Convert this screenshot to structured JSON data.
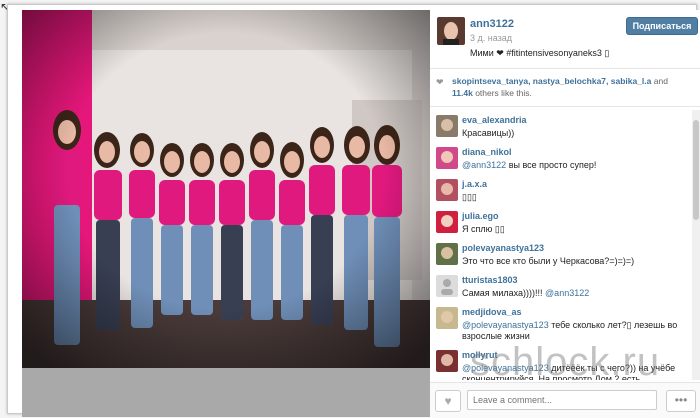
{
  "post": {
    "username": "ann3122",
    "time_ago": "3 д. назад",
    "caption": "Мими ❤ #fitintensivesonyaneks3 ▯",
    "follow_label": "Подписаться"
  },
  "likes": {
    "users": "skopintseva_tanya, nastya_belochka7, sabika_l.a",
    "and_word": "and",
    "count": "11.4k",
    "suffix": "others like this."
  },
  "comments": [
    {
      "author": "eva_alexandria",
      "text": "Красавицы))"
    },
    {
      "author": "diana_nikol",
      "mention": "@ann3122",
      "text": " вы все просто супер!"
    },
    {
      "author": "j.a.x.a",
      "text": "▯▯▯"
    },
    {
      "author": "julia.ego",
      "text": "Я сплю ▯▯"
    },
    {
      "author": "polevayanastya123",
      "text": "Это что все кто были у Черкасова?=)=)=)"
    },
    {
      "author": "tturistas1803",
      "text": "Самая милаха))))!!! ",
      "mention": "@ann3122"
    },
    {
      "author": "medjidova_as",
      "mention": "@polevayanastya123",
      "text": " тебе сколько лет?▯ лезешь во взрослые жизни"
    },
    {
      "author": "mollyrut",
      "mention": "@polevayanastya123",
      "text": " дитёёёк ты с чего?)) на учёбе сконцентрируйся. На просмотр Дом 2 есть"
    }
  ],
  "input": {
    "placeholder": "Leave a comment..."
  },
  "more_label": "•••",
  "watermark": "schlock.ru",
  "colors": {
    "accent": "#3f729b",
    "button": "#517fa4",
    "wall": "#e6177a"
  }
}
